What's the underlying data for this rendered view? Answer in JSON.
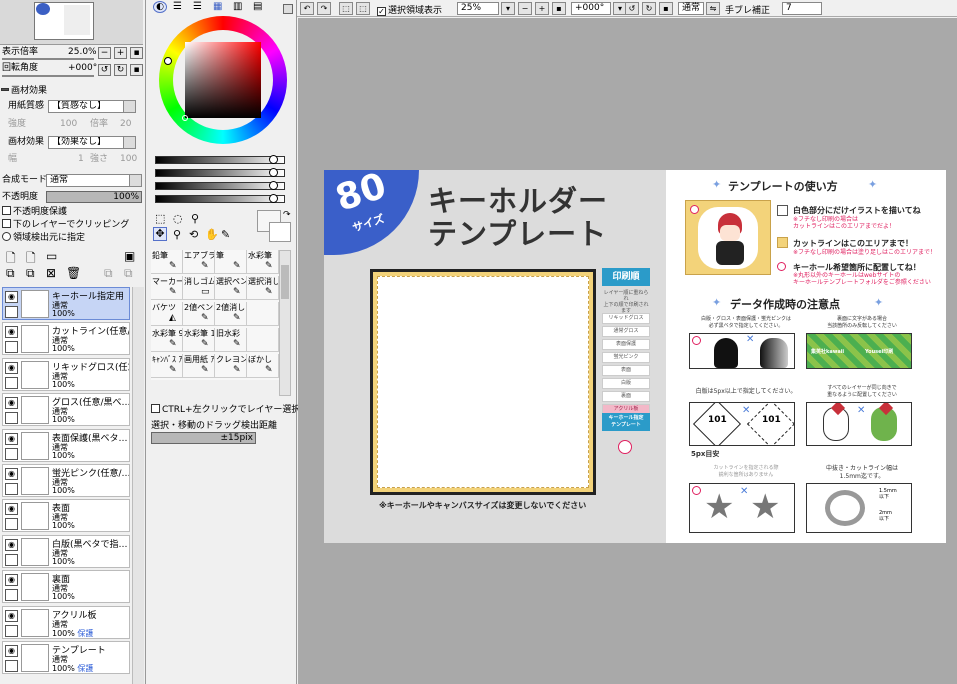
{
  "nav": {
    "zoom_label": "表示倍率",
    "zoom_value": "25.0%",
    "rotation_label": "回転角度",
    "rotation_value": "+000°",
    "btn_minus": "−",
    "btn_plus": "+"
  },
  "texture": {
    "section": "画材効果",
    "paper_label": "用紙質感",
    "paper_value": "【質感なし】",
    "intensity_label": "強度",
    "intensity_value": "100",
    "scale_label": "倍率",
    "scale_value": "20",
    "effect_label": "画材効果",
    "effect_value": "【効果なし】",
    "width_label": "幅",
    "width_value": "1",
    "strength_label": "強さ",
    "strength_value": "100"
  },
  "blend": {
    "mode_label": "合成モード",
    "mode_value": "通常",
    "opacity_label": "不透明度",
    "opacity_value": "100%",
    "protect_opacity": "不透明度保護",
    "clip_lower": "下のレイヤーでクリッピング",
    "select_source": "領域検出元に指定"
  },
  "layers": [
    {
      "name": "キーホール指定用",
      "mode": "通常",
      "opacity": "100%",
      "protect": "",
      "selected": true
    },
    {
      "name": "カットライン(任意/…",
      "mode": "通常",
      "opacity": "100%",
      "protect": "",
      "selected": false
    },
    {
      "name": "リキッドグロス(任意…",
      "mode": "通常",
      "opacity": "100%",
      "protect": "",
      "selected": false
    },
    {
      "name": "グロス(任意/黒べ…",
      "mode": "通常",
      "opacity": "100%",
      "protect": "",
      "selected": false
    },
    {
      "name": "表面保護(黒ベタ…",
      "mode": "通常",
      "opacity": "100%",
      "protect": "",
      "selected": false
    },
    {
      "name": "蛍光ピンク(任意/…",
      "mode": "通常",
      "opacity": "100%",
      "protect": "",
      "selected": false
    },
    {
      "name": "表面",
      "mode": "通常",
      "opacity": "100%",
      "protect": "",
      "selected": false
    },
    {
      "name": "白版(黒ベタで指…",
      "mode": "通常",
      "opacity": "100%",
      "protect": "",
      "selected": false
    },
    {
      "name": "裏面",
      "mode": "通常",
      "opacity": "100%",
      "protect": "",
      "selected": false
    },
    {
      "name": "アクリル板",
      "mode": "通常",
      "opacity": "100%",
      "protect": "保護",
      "selected": false
    },
    {
      "name": "テンプレート",
      "mode": "通常",
      "opacity": "100%",
      "protect": "保護",
      "selected": false
    }
  ],
  "colors": {
    "accent": "#3b5fc4",
    "selection": "#c6d5f5",
    "canvas_bg": "#a9a9a9",
    "template_gray": "#dcdcdc",
    "frame_yellow": "#f3d37a",
    "banner_blue": "#3a5fc9",
    "print_teal": "#2b9bc9",
    "highlight_pink": "#e02060"
  },
  "tools": [
    {
      "label": "鉛筆",
      "icon": "✎"
    },
    {
      "label": "エアブラシ",
      "icon": "✎"
    },
    {
      "label": "筆",
      "icon": "✎"
    },
    {
      "label": "水彩筆",
      "icon": "✎"
    },
    {
      "label": "マーカー",
      "icon": "✎"
    },
    {
      "label": "消しゴム",
      "icon": "▭"
    },
    {
      "label": "選択ペン",
      "icon": "✎"
    },
    {
      "label": "選択消し",
      "icon": "✎"
    },
    {
      "label": "バケツ",
      "icon": "◭"
    },
    {
      "label": "2値ペン",
      "icon": "✎"
    },
    {
      "label": "2値消し",
      "icon": "✎"
    },
    {
      "label": "",
      "icon": ""
    },
    {
      "label": "水彩筆 9版",
      "icon": "✎"
    },
    {
      "label": "水彩筆 10版",
      "icon": "✎"
    },
    {
      "label": "旧水彩",
      "icon": "✎"
    },
    {
      "label": "",
      "icon": ""
    },
    {
      "label": "ｷｬﾝﾊﾞｽ ｱｸﾘﾙ",
      "icon": "✎"
    },
    {
      "label": "画用紙 ｱｸﾘﾙ",
      "icon": "✎"
    },
    {
      "label": "クレヨン",
      "icon": "✎"
    },
    {
      "label": "ぼかし",
      "icon": "✎"
    }
  ],
  "options": {
    "ctrl_click": "CTRL+左クリックでレイヤー選択",
    "drag_label": "選択・移動のドラッグ検出距離",
    "drag_value": "±15pix"
  },
  "toolbar": {
    "show_selection": "選択領域表示",
    "zoom": "25%",
    "angle": "+000°",
    "blend": "通常",
    "stabilizer_label": "手ブレ補正",
    "stabilizer_value": "7"
  },
  "template": {
    "size_num": "80",
    "size_word": "サイズ",
    "title1": "キーホルダー",
    "title2": "テンプレート",
    "print_order": "印刷順",
    "print_note": "レイヤー順に重ねられ\n上下の順で印刷されます",
    "tags": [
      "リキッドグロス",
      "通常グロス",
      "表面保護",
      "蛍光ピンク",
      "表面",
      "白版",
      "裏面",
      "アクリル板"
    ],
    "keyhole_template": "キーホール指定\nテンプレート",
    "bottom_note": "※キーホールやキャンバスサイズは変更しないでください",
    "howto_title": "テンプレートの使い方",
    "howto_1": "白色部分にだけイラストを描いてね",
    "howto_1_sub": "※フチなし印刷の場合は\nカットラインはこのエリアまでだよ！",
    "howto_2": "カットラインはこのエリアまで！",
    "howto_2_sub": "※フチなし印刷の場合は塗り足しはこのエリアまで！",
    "howto_3": "キーホール希望箇所に配置してね！",
    "howto_3_sub": "※丸形以外のキーホールはwebサイトの\nキーホールテンプレートフォルダをご参照ください",
    "notes_title": "データ作成時の注意点",
    "note_a": "白版・グロス・表面保護・蛍光ピンクは\n必ず黒ベタで指定してください。",
    "note_b": "裏面に文字がある場合\n当該箇所のみ反転してください",
    "note_c": "白版は5px以上で指定してください。",
    "note_d": "すべてのレイヤーが同じ向きで\n重なるように配置してください",
    "note_e": "カットラインを指定される際\n鋭利な箇所はありません",
    "note_f": "中抜き・カットライン幅は\n1.5mm迄です。",
    "label_5px": "5px目安",
    "label_101": "101",
    "brand_a": "集英社kawaii",
    "brand_b": "Yousei印刷",
    "label_15mm": "1.5mm\n以下",
    "label_2mm": "2mm\n以下"
  }
}
